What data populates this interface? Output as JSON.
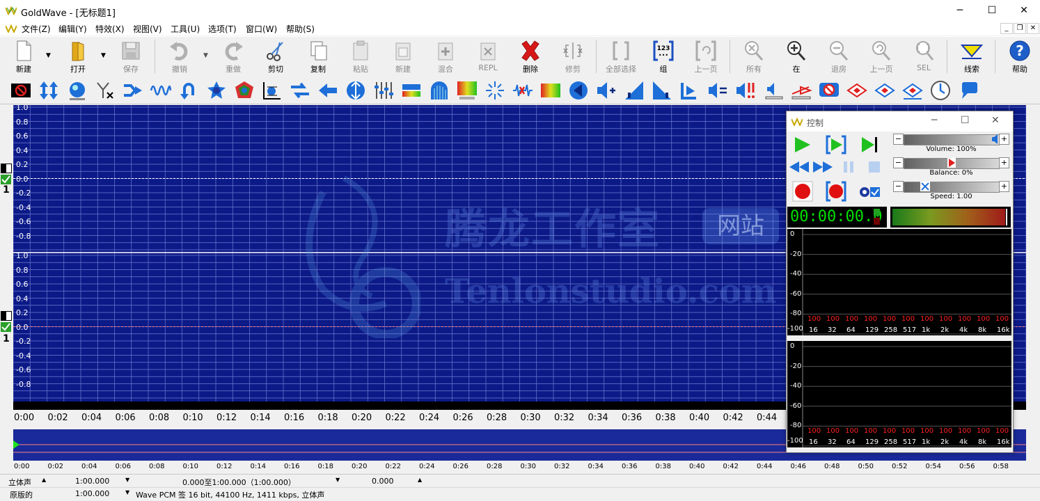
{
  "window": {
    "title": "GoldWave - [无标题1]",
    "min": "─",
    "max": "☐",
    "close": "✕"
  },
  "menu": [
    "文件(Z)",
    "编辑(Y)",
    "特效(X)",
    "视图(V)",
    "工具(U)",
    "选项(T)",
    "窗口(W)",
    "帮助(S)"
  ],
  "mdi": {
    "min": "_",
    "restore": "❐",
    "close": "✕"
  },
  "toolbar": {
    "new": "新建",
    "open": "打开",
    "save": "保存",
    "undo": "撤销",
    "redo": "重做",
    "cut": "剪切",
    "copy": "复制",
    "paste": "粘贴",
    "paste_new": "新建",
    "mix": "混合",
    "repl": "REPL",
    "delete": "删除",
    "trim": "修剪",
    "select_all": "全部选择",
    "group": "组",
    "prev_page": "上一页",
    "zoom_all": "所有",
    "zoom_in": "在",
    "zoom_out": "退房",
    "zoom_prev": "上一页",
    "zoom_sel": "SEL",
    "cue": "线索",
    "help": "帮助",
    "group_icon_text": "123"
  },
  "waveform": {
    "yticks": [
      "1.0",
      "0.8",
      "0.6",
      "0.4",
      "0.2",
      "0.0",
      "-0.2",
      "-0.4",
      "-0.6",
      "-0.8"
    ],
    "channel_number": "1"
  },
  "timeline": [
    "0:00",
    "0:02",
    "0:04",
    "0:06",
    "0:08",
    "0:10",
    "0:12",
    "0:14",
    "0:16",
    "0:18",
    "0:20",
    "0:22",
    "0:24",
    "0:26",
    "0:28",
    "0:30",
    "0:32",
    "0:34",
    "0:36",
    "0:38",
    "0:40",
    "0:42",
    "0:44"
  ],
  "overview_timeline": [
    "0:00",
    "0:02",
    "0:04",
    "0:06",
    "0:08",
    "0:10",
    "0:12",
    "0:14",
    "0:16",
    "0:18",
    "0:20",
    "0:22",
    "0:24",
    "0:26",
    "0:28",
    "0:30",
    "0:32",
    "0:34",
    "0:36",
    "0:38",
    "0:40",
    "0:42",
    "0:44",
    "0:46",
    "0:48",
    "0:50",
    "0:52",
    "0:54",
    "0:56",
    "0:58"
  ],
  "watermark": {
    "cn": "腾龙工作室",
    "badge": "网站",
    "en": "Tenlonstudio.com"
  },
  "status": {
    "channels": "立体声",
    "length": "1:00.000",
    "selection": "0.000至1:00.000（1:00.000）",
    "position": "0.000",
    "original": "原版的",
    "original_length": "1:00.000",
    "format": "Wave PCM 签 16 bit, 44100 Hz, 1411 kbps, 立体声"
  },
  "control": {
    "title": "控制",
    "volume_label": "Volume: 100%",
    "volume": 1.0,
    "balance_label": "Balance: 0%",
    "balance": 0.5,
    "speed_label": "Speed: 1.00",
    "speed": 0.22,
    "time": "00:00:00.0",
    "spec_y": [
      "0",
      "-20",
      "-40",
      "-60",
      "-80",
      "-100"
    ],
    "spec_x": [
      "16",
      "32",
      "64",
      "129",
      "258",
      "517",
      "1k",
      "2k",
      "4k",
      "8k",
      "16k"
    ],
    "spec_val": "100"
  },
  "colors": {
    "wave_bg": "#0c1a88",
    "grid": "#6f7ad0",
    "accent_blue": "#0078d7",
    "red": "#e02020",
    "green": "#1db31d"
  }
}
